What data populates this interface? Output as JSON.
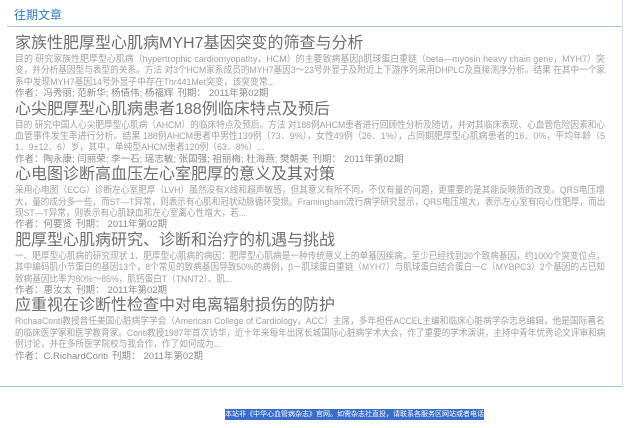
{
  "section": {
    "title": "往期文章"
  },
  "articles": [
    {
      "title": "家族性肥厚型心肌病MYH7基因突变的筛查与分析",
      "abstract_lines": [
        "目的 研究家族性肥厚型心肌病（hypertrophic cardiomyopathy，HCM）的主要致病基因β肌球蛋白重链（beta—myosin heavy chain gene，MYH7）突",
        "变，并分析基因型与表型的关系。方法 对3个HCM家系成员的MYH7基因3～23号外显子及附近上下游序列采用DHPLC及直接测序分析。结果 在其中一个家",
        "系中发现MYH7基因14号外显子中存在Thr441Met突变，该突变常..."
      ],
      "author_label": "作者：",
      "authors": "冯秀丽; 范新华; 杨倩伟; 杨福辉",
      "issue_label": "刊期：",
      "issue": "2011年第02期"
    },
    {
      "title": "心尖肥厚型心肌病患者188例临床特点及预后",
      "abstract_lines": [
        "目的 研究中国人心尖肥厚型心肌病（AHCM）的临床特点及预后。方法 对188例AHCM患者进行回顾性分析及随访，并对其临床表现、心血管危险因素和心",
        "血管事件发生率进行分析。结果 188例AHCM患者中男性139例（73．9%），女性49例（26．1%），占同期肥厚型心肌病患者的16．0%，平均年龄（5",
        "1．9±12．6）岁，其中，单纯型AHCM患者120例（63．8%）..."
      ],
      "author_label": "作者：",
      "authors": "陶永康; 闫丽荣; 李一石; 瑶志敏; 张国强; 祖丽梅; 杜海燕; 樊朝美",
      "issue_label": "刊期：",
      "issue": "2011年第02期"
    },
    {
      "title": "心电图诊断高血压左心室肥厚的意义及其对策",
      "abstract_lines": [
        "采用心电图（ECG）诊断左心室肥厚（LVH）虽然没有X线和超声敏感，但其意义有所不同，不仅有量的问题，更重要的是其能反映质的改变。QRS电压增",
        "大，量的成分多一些，而ST—T异常，则表示有心肌和冠状动脉循环受损。Framingham流行病学研究显示，QRS电压增大，表示左心室有向心性肥厚，而出",
        "现ST—T异常，则表示有心肌缺血和左心室离心性增大，若..."
      ],
      "author_label": "作者：",
      "authors": "何要贤",
      "issue_label": "刊期：",
      "issue": "2011年第02期"
    },
    {
      "title": "肥厚型心肌病研究、诊断和治疗的机遇与挑战",
      "abstract_lines": [
        "一、肥厚型心肌病的研究现状 1．肥厚型心肌病的病因：肥厚型心肌病是一种传统意义上的单基因疾病，至少已经找到20个致病基因，约1000个突变位点，",
        "其中编码肌小节蛋白的基因13个，8个常见的致病基因导致50%的病例，β－肌球蛋白重链（MYH7）与肌球蛋白结合蛋白－C（MYBPC3）2个基因的占已知",
        "致病基因比率为80%～85%，肌钙蛋白T（TNNT2）、肌..."
      ],
      "author_label": "作者：",
      "authors": "惠汝太",
      "issue_label": "刊期：",
      "issue": "2011年第02期"
    },
    {
      "title": "应重视在诊断性检查中对电离辐射损伤的防护",
      "abstract_lines": [
        "RichaaConti教授曾任美国心脏病学学会（American College of Cardiology，ACC）主席，多年担任ACCEL主编和临床心脏病学杂志总编辑，他是国际著名",
        "的临床医学家和医学教育家。Conti教授1987年首次访华，近十年来每年出席长城国际心脏病学术大会，作了重要的学术演讲，主持中青年优秀论文评审和病",
        "例讨论，并在多所医学院校与我合作，作了如何成为..."
      ],
      "author_label": "作者：",
      "authors": "C.RichardConti",
      "issue_label": "刊期：",
      "issue": "2011年第02期"
    }
  ],
  "footer": {
    "notice": "本站非《中华心血管病杂志》官网。如需杂志社直投，请联系各服务区网站或者电话"
  },
  "colors": {
    "accent": "#2f7cc4",
    "title": "#6f6f6f",
    "abstract": "#a3a3a3",
    "meta": "#8c8c8c",
    "rule": "#a9c7e4",
    "border": "#d3dfeb",
    "selection_bg": "#3a6cc9",
    "selection_text": "#ffffff"
  }
}
